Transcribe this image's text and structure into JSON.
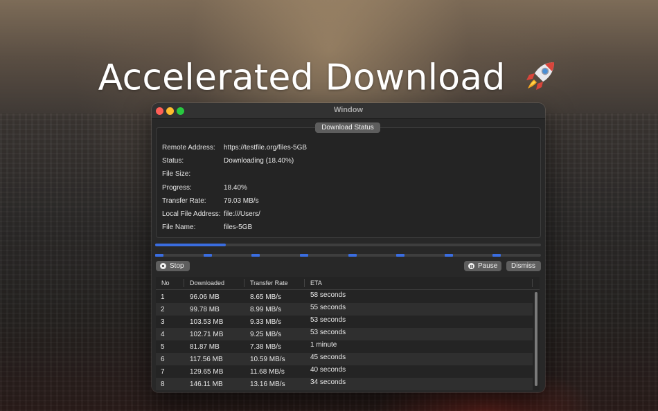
{
  "hero": {
    "title": "Accelerated Download"
  },
  "window": {
    "title": "Window"
  },
  "status_box": {
    "title": "Download Status",
    "rows": [
      {
        "label": "Remote Address:",
        "value": "https://testfile.org/files-5GB"
      },
      {
        "label": "Status:",
        "value": "Downloading (18.40%)"
      },
      {
        "label": "File Size:",
        "value": ""
      },
      {
        "label": "Progress:",
        "value": "18.40%"
      },
      {
        "label": "Transfer Rate:",
        "value": "79.03 MB/s"
      },
      {
        "label": "Local File Address:",
        "value": "file:///Users/"
      },
      {
        "label": "File Name:",
        "value": "files-5GB"
      }
    ]
  },
  "progress": {
    "overall_fraction": 0.184,
    "segment_count": 8
  },
  "buttons": {
    "stop": "Stop",
    "pause": "Pause",
    "dismiss": "Dismiss"
  },
  "table": {
    "columns": [
      "No",
      "Downloaded",
      "Transfer Rate",
      "ETA"
    ],
    "rows": [
      [
        "1",
        "96.06 MB",
        "8.65 MB/s",
        "58 seconds"
      ],
      [
        "2",
        "99.78 MB",
        "8.99 MB/s",
        "55 seconds"
      ],
      [
        "3",
        "103.53 MB",
        "9.33 MB/s",
        "53 seconds"
      ],
      [
        "4",
        "102.71 MB",
        "9.25 MB/s",
        "53 seconds"
      ],
      [
        "5",
        "81.87 MB",
        "7.38 MB/s",
        "1 minute"
      ],
      [
        "6",
        "117.56 MB",
        "10.59 MB/s",
        "45 seconds"
      ],
      [
        "7",
        "129.65 MB",
        "11.68 MB/s",
        "40 seconds"
      ],
      [
        "8",
        "146.11 MB",
        "13.16 MB/s",
        "34 seconds"
      ]
    ]
  },
  "colors": {
    "accent": "#3a6de0",
    "close": "#ff5f57",
    "minimize": "#febc2e",
    "maximize": "#28c840"
  }
}
